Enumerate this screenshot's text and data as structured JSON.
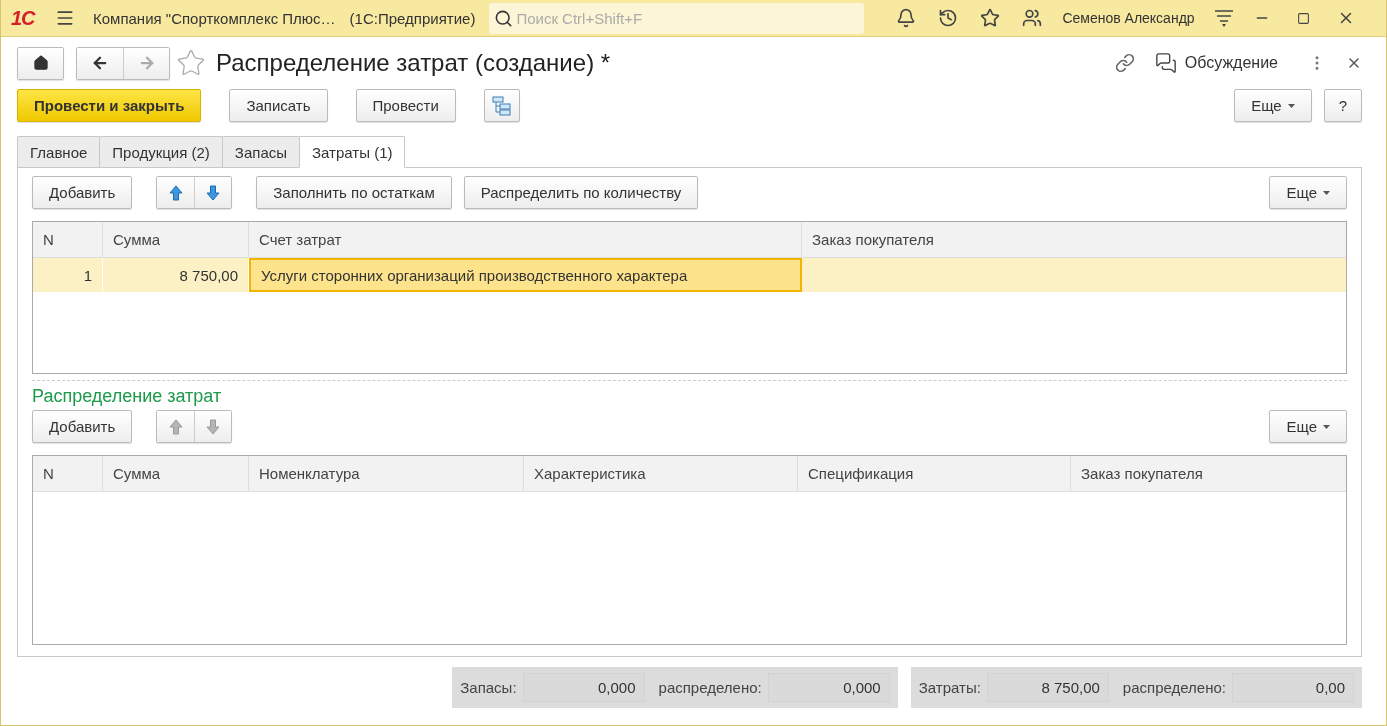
{
  "titlebar": {
    "logo": "1С",
    "title": "Компания \"Спорткомплекс Плюс…",
    "app": "(1С:Предприятие)",
    "search": {
      "placeholder": "Поиск Ctrl+Shift+F"
    },
    "user": "Семенов Александр"
  },
  "form": {
    "title": "Распределение затрат (создание) *",
    "favorite": false,
    "discussion": "Обсуждение"
  },
  "commands": [
    {
      "kind": "primary",
      "label": "Провести и закрыть"
    },
    {
      "kind": "default",
      "label": "Записать"
    },
    {
      "kind": "default",
      "label": "Провести"
    },
    {
      "kind": "structure"
    }
  ],
  "command_more": "Еще",
  "help": "?",
  "tabs": [
    {
      "label": "Главное",
      "selected": false
    },
    {
      "label": "Продукция (2)",
      "selected": false
    },
    {
      "label": "Запасы",
      "selected": false
    },
    {
      "label": "Затраты (1)",
      "selected": true
    }
  ],
  "costs": {
    "add": "Добавить",
    "arrows_disabled": false,
    "buttons": [
      "Заполнить по остаткам",
      "Распределить по количеству"
    ],
    "more": "Еще",
    "columns": [
      "N",
      "Сумма",
      "Счет затрат",
      "Заказ покупателя"
    ],
    "rows": [
      {
        "n": "1",
        "sum": "8 750,00",
        "account": "Услуги сторонних организаций производственного характера",
        "selected": true
      }
    ]
  },
  "distribution": {
    "title": "Распределение затрат",
    "add": "Добавить",
    "arrows_disabled": true,
    "more": "Еще",
    "columns": [
      "N",
      "Сумма",
      "Номенклатура",
      "Характеристика",
      "Спецификация",
      "Заказ покупателя"
    ]
  },
  "totals": [
    {
      "label": "Запасы:",
      "value": "0,000",
      "dist_label": "распределено:",
      "dist_value": "0,000"
    },
    {
      "label": "Затраты:",
      "value": "8 750,00",
      "dist_label": "распределено:",
      "dist_value": "0,00"
    }
  ]
}
